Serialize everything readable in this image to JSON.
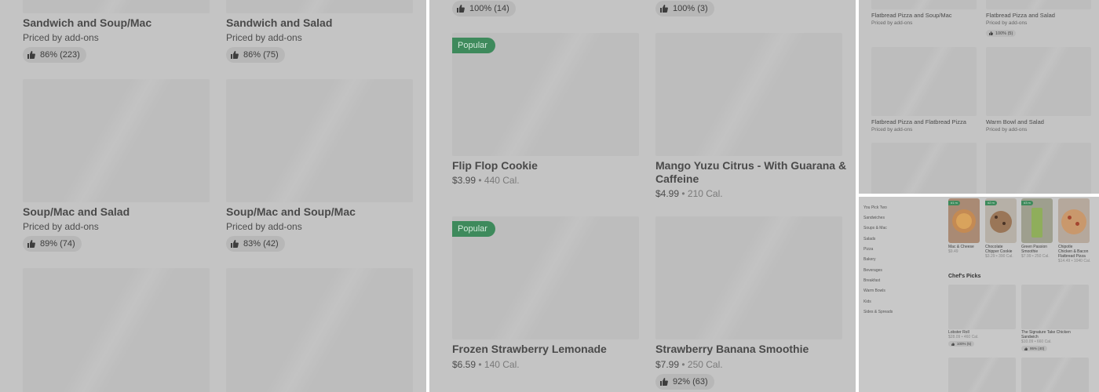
{
  "panel1": {
    "items": [
      {
        "name": "Sandwich and Soup/Mac",
        "sub": "Priced by add-ons",
        "rating": "86% (223)"
      },
      {
        "name": "Sandwich and Salad",
        "sub": "Priced by add-ons",
        "rating": "86% (75)"
      },
      {
        "name": "Soup/Mac and Salad",
        "sub": "Priced by add-ons",
        "rating": "89% (74)"
      },
      {
        "name": "Soup/Mac and Soup/Mac",
        "sub": "Priced by add-ons",
        "rating": "83% (42)"
      }
    ]
  },
  "panel2": {
    "top_ratings": [
      "100% (14)",
      "100% (3)"
    ],
    "popular_label": "Popular",
    "items": [
      {
        "name": "Flip Flop Cookie",
        "price": "$3.99",
        "cal": "440 Cal.",
        "popular": true
      },
      {
        "name1": "Mango Yuzu Citrus - With Guarana &",
        "name2": "Caffeine",
        "price": "$4.99",
        "cal": "210 Cal."
      },
      {
        "name": "Frozen Strawberry Lemonade",
        "price": "$6.59",
        "cal": "140 Cal.",
        "popular": true
      },
      {
        "name": "Strawberry Banana Smoothie",
        "price": "$7.99",
        "cal": "250 Cal.",
        "rating": "92% (63)"
      }
    ]
  },
  "panel3": {
    "items": [
      {
        "name": "Flatbread Pizza and Soup/Mac",
        "sub": "Priced by add-ons"
      },
      {
        "name": "Flatbread Pizza and Salad",
        "sub": "Priced by add-ons",
        "rating": "100% (5)"
      },
      {
        "name": "Flatbread Pizza and Flatbread Pizza",
        "sub": "Priced by add-ons"
      },
      {
        "name": "Warm Bowl and Salad",
        "sub": "Priced by add-ons"
      }
    ]
  },
  "panel4": {
    "sidebar": [
      "You Pick Two",
      "Sandwiches",
      "Soups & Mac",
      "Salads",
      "Pizza",
      "Bakery",
      "Beverages",
      "Breakfast",
      "Warm Bowls",
      "Kids",
      "Sides & Spreads"
    ],
    "top_items": [
      {
        "tag": "#1 m",
        "name1": "Mac & Cheese",
        "name2": "",
        "name3": "",
        "price": "$9.49",
        "cal": ""
      },
      {
        "tag": "#2 m",
        "name1": "Chocolate",
        "name2": "Chipper Cookie",
        "name3": "",
        "price": "$3.29",
        "cal": "390 Cal."
      },
      {
        "tag": "#3 m",
        "name1": "Green Passion",
        "name2": "Smoothie",
        "name3": "",
        "price": "$7.99",
        "cal": "250 Cal."
      },
      {
        "tag": "",
        "name1": "Chipotle",
        "name2": "Chicken & Bacon",
        "name3": "Flatbread Pizza",
        "price": "$14.49",
        "cal": "1040 Cal."
      }
    ],
    "chefs_heading": "Chef's Picks",
    "chef_items": [
      {
        "name1": "Lobster Roll",
        "name2": "",
        "price": "$28.09",
        "cal": "460 Cal.",
        "rating": "100% (5)"
      },
      {
        "name1": "The Signature Take Chicken",
        "name2": "Sandwich",
        "price": "$10.09",
        "cal": "660 Cal.",
        "rating": "95% (40)"
      }
    ]
  },
  "colors": {
    "popular": "#3e8a5c",
    "panel_bg": "#c4c4c4",
    "tile": "#bdbdbd"
  }
}
